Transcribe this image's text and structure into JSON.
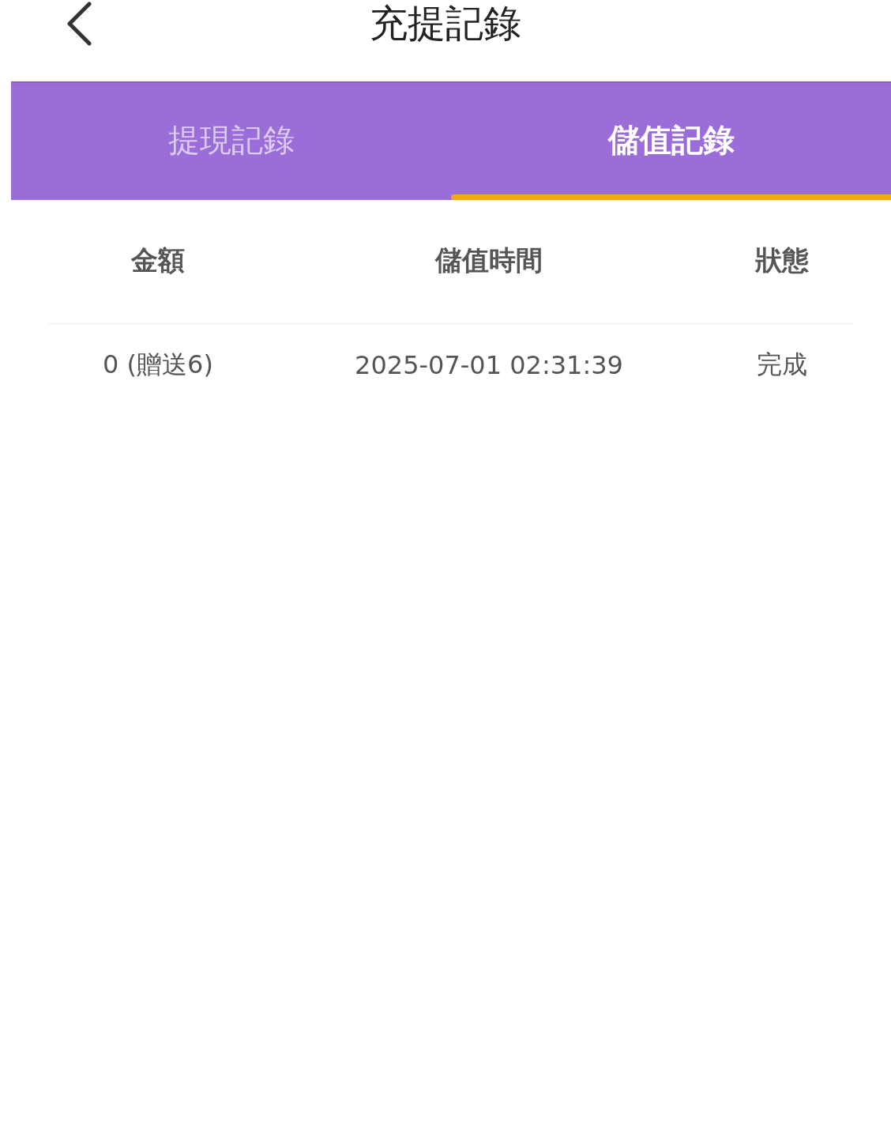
{
  "header": {
    "title": "充提記錄"
  },
  "tabs": [
    {
      "label": "提現記錄",
      "selected": false
    },
    {
      "label": "儲值記錄",
      "selected": true
    }
  ],
  "table": {
    "columns": [
      "金額",
      "儲值時間",
      "狀態"
    ],
    "rows": [
      [
        "0 (贈送6)",
        "2025-07-01 02:31:39",
        "完成"
      ]
    ]
  }
}
